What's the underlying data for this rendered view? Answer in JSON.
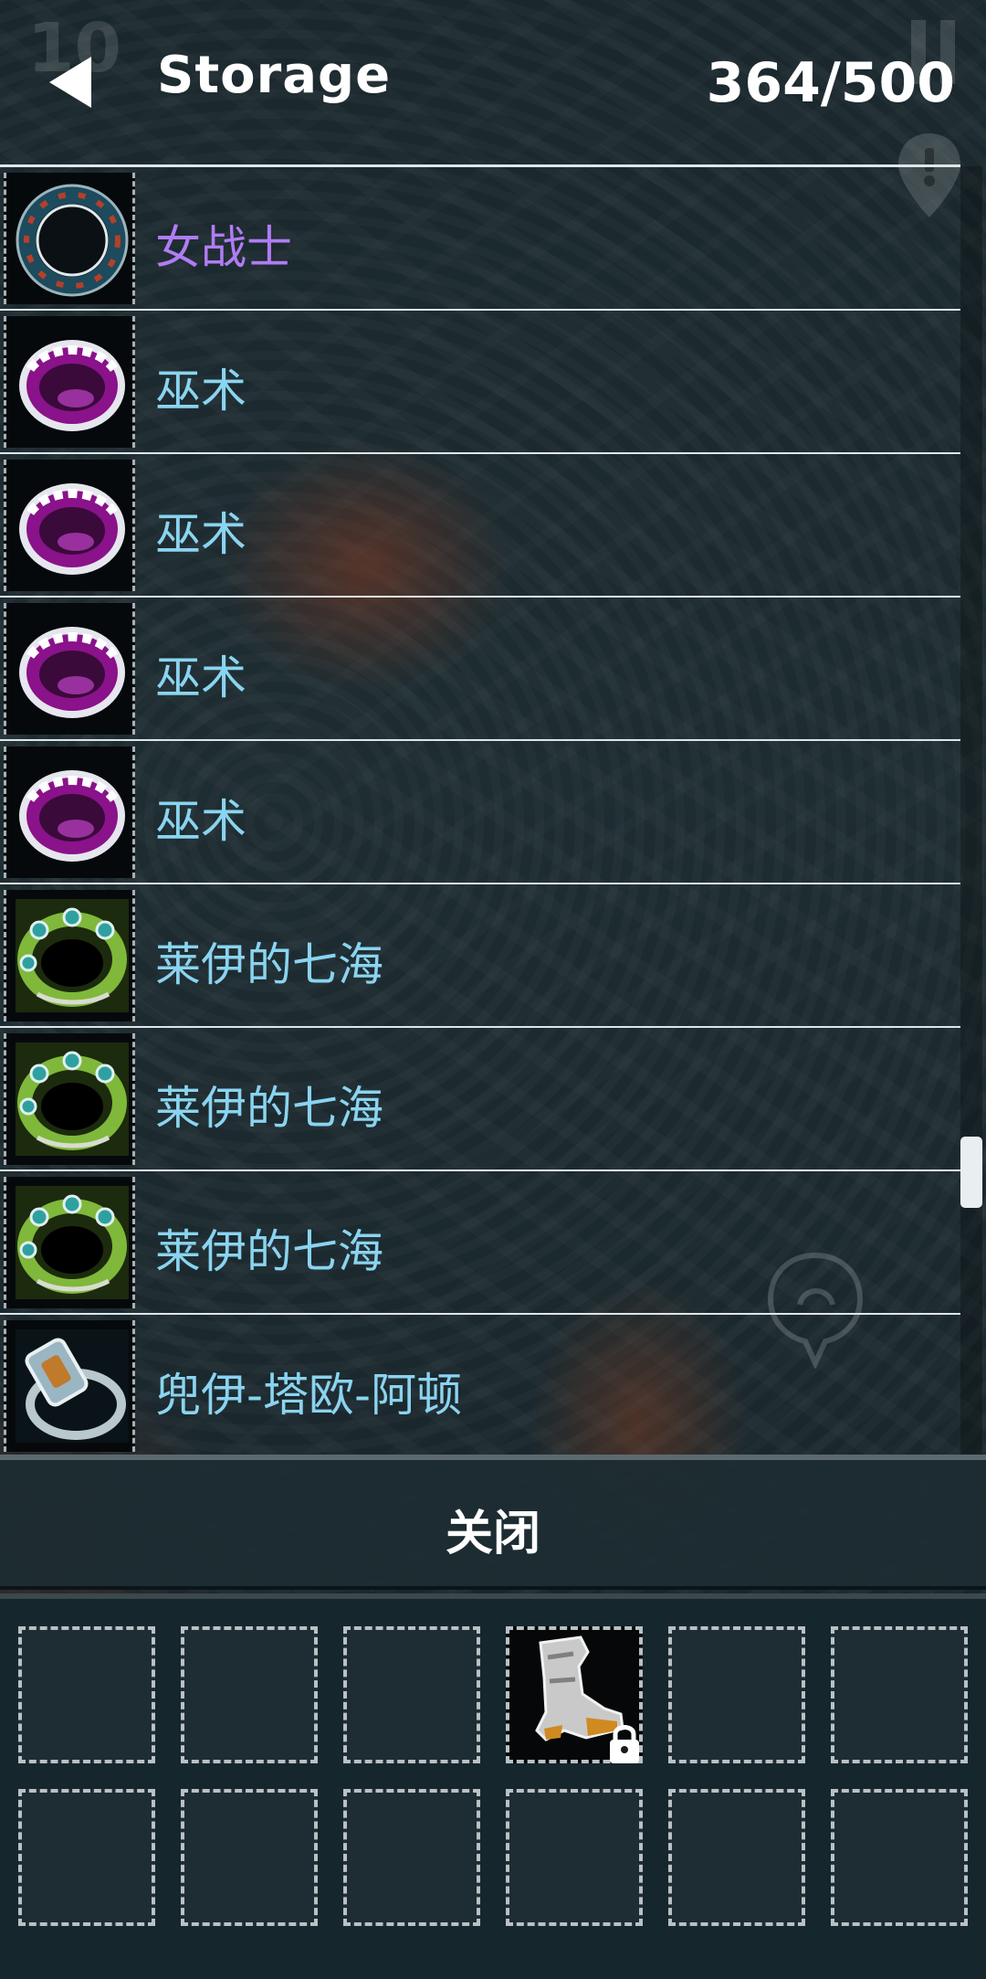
{
  "header": {
    "title": "Storage",
    "count": "364/500",
    "corner_number": "10"
  },
  "list": {
    "items": [
      {
        "label": "女战士",
        "color": "#b07cf4",
        "icon": "ring-black-icon"
      },
      {
        "label": "巫术",
        "color": "#8ad4f0",
        "icon": "ring-purple-icon"
      },
      {
        "label": "巫术",
        "color": "#8ad4f0",
        "icon": "ring-purple-icon"
      },
      {
        "label": "巫术",
        "color": "#8ad4f0",
        "icon": "ring-purple-icon"
      },
      {
        "label": "巫术",
        "color": "#8ad4f0",
        "icon": "ring-purple-icon"
      },
      {
        "label": "莱伊的七海",
        "color": "#8ad4f0",
        "icon": "ring-green-icon"
      },
      {
        "label": "莱伊的七海",
        "color": "#8ad4f0",
        "icon": "ring-green-icon"
      },
      {
        "label": "莱伊的七海",
        "color": "#8ad4f0",
        "icon": "ring-green-icon"
      },
      {
        "label": "兜伊-塔欧-阿顿",
        "color": "#8ad4f0",
        "icon": "ring-gem-icon"
      }
    ]
  },
  "close_button": {
    "label": "关闭"
  },
  "inventory": {
    "slots": [
      {
        "item": ""
      },
      {
        "item": ""
      },
      {
        "item": ""
      },
      {
        "item": "boots-icon",
        "locked": true
      },
      {
        "item": ""
      },
      {
        "item": ""
      },
      {
        "item": ""
      },
      {
        "item": ""
      },
      {
        "item": ""
      },
      {
        "item": ""
      },
      {
        "item": ""
      },
      {
        "item": ""
      }
    ]
  },
  "colors": {
    "label_blue": "#8ad4f0",
    "label_purple": "#b07cf4",
    "divider": "#dfe6ea"
  }
}
